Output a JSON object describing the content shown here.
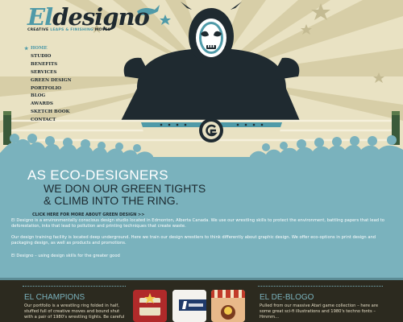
{
  "logo": {
    "el": "El",
    "rest": "designo",
    "tagline_a": "CREATIVE ",
    "tagline_b": "LEAPS & FINISHING",
    "tagline_c": " MOVES"
  },
  "nav": {
    "items": [
      {
        "label": "HOME",
        "active": true
      },
      {
        "label": "STUDIO"
      },
      {
        "label": "BENEFITS"
      },
      {
        "label": "SERVICES"
      },
      {
        "label": "GREEN DESIGN"
      },
      {
        "label": "PORTFOLIO"
      },
      {
        "label": "BLOG"
      },
      {
        "label": "AWARDS"
      },
      {
        "label": "SKETCH BOOK"
      },
      {
        "label": "CONTACT"
      }
    ]
  },
  "hero": {
    "headline_1": "AS ECO-DESIGNERS",
    "headline_2": "WE DON OUR GREEN TIGHTS",
    "headline_3": "& CLIMB INTO THE RING.",
    "cta": "CLICK HERE FOR MORE ABOUT GREEN DESIGN >>",
    "para_1": "El Designo is a environmentally conscious design studio located in Edmonton, Alberta Canada. We use our wrestling skills to protect the environment, battling papers that lead to deforestation, inks that lead to pollution and printing techniques that create waste.",
    "para_2": "Our design training facility is located deep underground. Here we train our design wrestlers to think differently about graphic design. We offer eco-options in print design and packaging design, as well as products and promotions.",
    "para_3": "El Designo – using design skills for the greater good"
  },
  "footer": {
    "champions_title": "EL CHAMPIONS",
    "champions_text": "Our portfolio is a wrestling ring folded in half, stuffed full of creative moves and bound shut with a pair of 1980's wrestling tights. Be careful",
    "blog_title": "EL DE-BLOGO",
    "blog_text": "Pulled from our massive Atari game collection – here are some great sci-fi illustrations and 1980's techno fonts – Hmmm..."
  },
  "colors": {
    "teal": "#7ab2bd",
    "dark": "#2c2a1f",
    "cream": "#e9e2c3",
    "navy": "#1f2a30"
  }
}
